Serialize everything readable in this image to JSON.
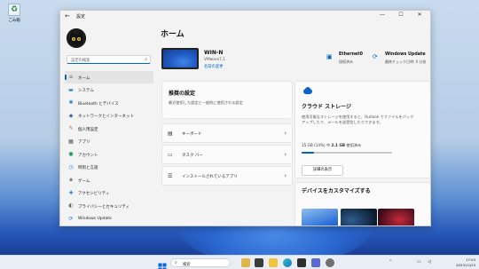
{
  "desktop": {
    "recycle_label": "ごみ箱"
  },
  "window": {
    "title": "設定",
    "back_icon": "←",
    "min_icon": "—",
    "max_icon": "☐",
    "close_icon": "✕"
  },
  "sidebar": {
    "search_placeholder": "設定の検索",
    "items": [
      {
        "label": "ホーム",
        "icon": "home-icon",
        "glyph": "⌂",
        "color": "#555555",
        "active": true
      },
      {
        "label": "システム",
        "icon": "system-icon",
        "glyph": "▬",
        "color": "#2b7fd8"
      },
      {
        "label": "Bluetooth とデバイス",
        "icon": "bluetooth-icon",
        "glyph": "✱",
        "color": "#2b7fd8"
      },
      {
        "label": "ネットワークとインターネット",
        "icon": "network-icon",
        "glyph": "◆",
        "color": "#3a6fb5"
      },
      {
        "label": "個人用設定",
        "icon": "personalization-icon",
        "glyph": "✎",
        "color": "#c8632b"
      },
      {
        "label": "アプリ",
        "icon": "apps-icon",
        "glyph": "▦",
        "color": "#555555"
      },
      {
        "label": "アカウント",
        "icon": "account-icon",
        "glyph": "●",
        "color": "#2fa36b"
      },
      {
        "label": "時刻と言語",
        "icon": "time-language-icon",
        "glyph": "◷",
        "color": "#2b7fd8"
      },
      {
        "label": "ゲーム",
        "icon": "gaming-icon",
        "glyph": "◈",
        "color": "#666666"
      },
      {
        "label": "アクセシビリティ",
        "icon": "accessibility-icon",
        "glyph": "✚",
        "color": "#2b7fd8"
      },
      {
        "label": "プライバシーとセキュリティ",
        "icon": "privacy-icon",
        "glyph": "◐",
        "color": "#666666"
      },
      {
        "label": "Windows Update",
        "icon": "windows-update-icon",
        "glyph": "⟳",
        "color": "#2b7fd8"
      }
    ]
  },
  "main": {
    "title": "ホーム",
    "pc": {
      "name": "WIN-N",
      "model": "VMware7,1",
      "rename": "名前の変更"
    },
    "ethernet": {
      "title": "Ethernet0",
      "status": "接続済み"
    },
    "update": {
      "title": "Windows Update",
      "status": "最終チェック日時: 0 分前"
    },
    "recommended": {
      "title": "推奨の設定",
      "subtitle": "最近使用した設定と一般的に使用される設定",
      "rows": [
        {
          "label": "キーボード",
          "icon": "keyboard-icon",
          "glyph": "▤"
        },
        {
          "label": "タスク バー",
          "icon": "taskbar-icon",
          "glyph": "▭"
        },
        {
          "label": "インストールされているアプリ",
          "icon": "installed-apps-icon",
          "glyph": "☰"
        }
      ],
      "chevron": "›"
    },
    "cloud": {
      "title": "クラウド ストレージ",
      "description": "使用可能なストレージを使用すると、Outlook でファイルをバックアップしたり、メールを送受信したりできます。",
      "usage_prefix": "15 GB (14%) 中",
      "usage_bold": "2.1 GB",
      "usage_suffix": "使用済み",
      "usage_fraction": 0.14,
      "button": "詳細の表示"
    },
    "customize": {
      "title": "デバイスをカスタマイズする"
    }
  },
  "taskbar": {
    "search_placeholder": "検索",
    "time": "17:03",
    "date": "2023/12/23"
  },
  "colors": {
    "accent": "#0067c0"
  }
}
